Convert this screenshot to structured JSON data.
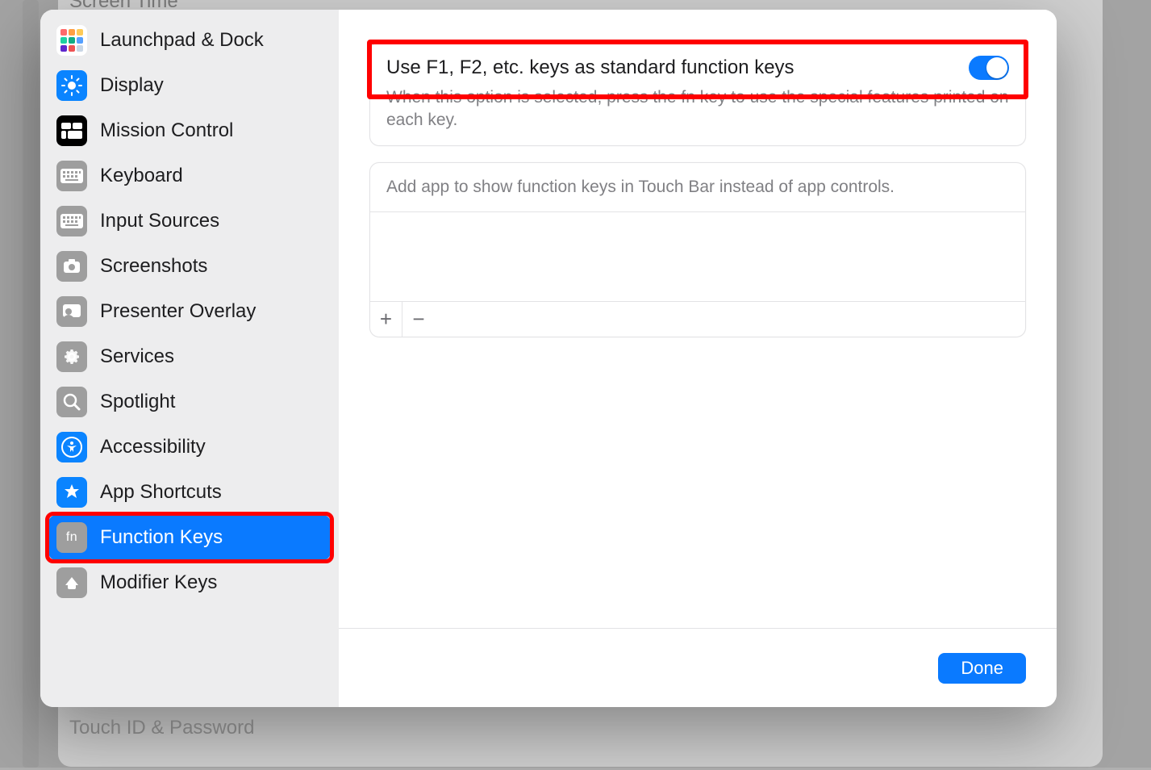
{
  "sidebar": {
    "items": [
      {
        "id": "launchpad",
        "label": "Launchpad & Dock"
      },
      {
        "id": "display",
        "label": "Display"
      },
      {
        "id": "mission-control",
        "label": "Mission Control"
      },
      {
        "id": "keyboard",
        "label": "Keyboard"
      },
      {
        "id": "input-sources",
        "label": "Input Sources"
      },
      {
        "id": "screenshots",
        "label": "Screenshots"
      },
      {
        "id": "presenter-overlay",
        "label": "Presenter Overlay"
      },
      {
        "id": "services",
        "label": "Services"
      },
      {
        "id": "spotlight",
        "label": "Spotlight"
      },
      {
        "id": "accessibility",
        "label": "Accessibility"
      },
      {
        "id": "app-shortcuts",
        "label": "App Shortcuts"
      },
      {
        "id": "function-keys",
        "label": "Function Keys",
        "selected": true
      },
      {
        "id": "modifier-keys",
        "label": "Modifier Keys"
      }
    ]
  },
  "occluded": {
    "top": "Screen Time",
    "bottom": "Touch ID & Password"
  },
  "main": {
    "option_title": "Use F1, F2, etc. keys as standard function keys",
    "option_desc": "When this option is selected, press the fn key to use the special features printed on each key.",
    "option_enabled": true,
    "app_list_hint": "Add app to show function keys in Touch Bar instead of app controls.",
    "add_glyph": "+",
    "remove_glyph": "−"
  },
  "footer": {
    "done": "Done"
  },
  "icons": {
    "launchpad_colors": [
      "#ff6b6b",
      "#ff9f43",
      "#feca57",
      "#1dd1a1",
      "#10ac84",
      "#54a0ff",
      "#5f27cd",
      "#ee5253",
      "#c8d6e5"
    ],
    "fn_text": "fn"
  }
}
